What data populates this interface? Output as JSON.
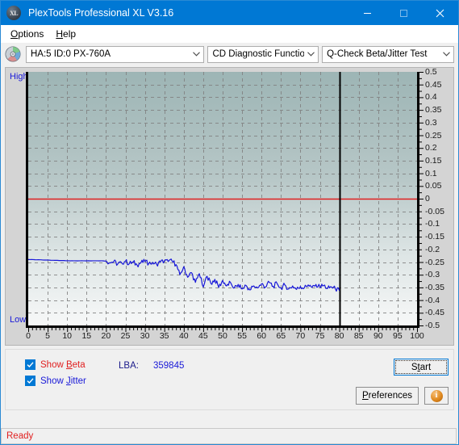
{
  "window": {
    "title": "PlexTools Professional XL V3.16",
    "app_icon": "XL",
    "minimize_label": "–",
    "maximize_label": "□",
    "close_label": "✕"
  },
  "menubar": {
    "items": [
      {
        "label": "Options",
        "accel": "O"
      },
      {
        "label": "Help",
        "accel": "H"
      }
    ]
  },
  "toolbar": {
    "drive_icon": "disc-icon",
    "drive_value": "HA:5 ID:0  PX-760A",
    "function_value": "CD Diagnostic Functions",
    "test_value": "Q-Check Beta/Jitter Test",
    "arrow": "∨"
  },
  "chart_panel": {
    "high_label": "High",
    "low_label": "Low"
  },
  "controls": {
    "show_beta_label": "Show Beta",
    "show_beta_accel": "B",
    "show_beta_checked": true,
    "show_jitter_label": "Show Jitter",
    "show_jitter_accel": "J",
    "show_jitter_checked": true,
    "lba_label": "LBA:",
    "lba_value": "359845",
    "start_label": "Start",
    "start_accel": "t",
    "preferences_label": "Preferences",
    "preferences_accel": "P",
    "info_label": "i"
  },
  "statusbar": {
    "text": "Ready"
  },
  "colors": {
    "titlebar": "#0078d4",
    "beta_line": "#1818d8",
    "zero_line": "#e02020",
    "beta_label": "#e02020",
    "jitter_label": "#1818d8",
    "status_text": "#e02020",
    "plot_top": "#9db5b5",
    "plot_bottom": "#f7f8f8",
    "gridline": "#808080"
  },
  "chart_data": {
    "type": "line",
    "title": "Q-Check Beta/Jitter Test",
    "xlabel": "",
    "ylabel": "",
    "xlim": [
      0,
      100
    ],
    "ylim": [
      -0.5,
      0.5
    ],
    "grid": true,
    "legend_position": "none",
    "x_ticks": [
      0,
      5,
      10,
      15,
      20,
      25,
      30,
      35,
      40,
      45,
      50,
      55,
      60,
      65,
      70,
      75,
      80,
      85,
      90,
      95,
      100
    ],
    "y_ticks": [
      0.5,
      0.45,
      0.4,
      0.35,
      0.3,
      0.25,
      0.2,
      0.15,
      0.1,
      0.05,
      0,
      -0.05,
      -0.1,
      -0.15,
      -0.2,
      -0.25,
      -0.3,
      -0.35,
      -0.4,
      -0.45,
      -0.5
    ],
    "y_axis_left_labels": [
      "High",
      "Low"
    ],
    "annotations": [
      {
        "type": "hline",
        "y": 0,
        "color": "#e02020",
        "label": "zero-reference"
      },
      {
        "type": "vline",
        "x": 80,
        "color": "#000000",
        "label": "data-end-marker"
      }
    ],
    "series": [
      {
        "name": "Beta",
        "color": "#1818d8",
        "x": [
          0,
          1,
          2,
          3,
          4,
          5,
          6,
          7,
          8,
          9,
          10,
          11,
          12,
          13,
          14,
          15,
          16,
          17,
          18,
          19,
          20,
          21,
          22,
          23,
          24,
          25,
          26,
          27,
          28,
          29,
          30,
          31,
          32,
          33,
          34,
          35,
          36,
          37,
          38,
          39,
          40,
          41,
          42,
          43,
          44,
          45,
          46,
          47,
          48,
          49,
          50,
          51,
          52,
          53,
          54,
          55,
          56,
          57,
          58,
          59,
          60,
          61,
          62,
          63,
          64,
          65,
          66,
          67,
          68,
          69,
          70,
          71,
          72,
          73,
          74,
          75,
          76,
          77,
          78,
          79,
          80
        ],
        "values": [
          -0.24,
          -0.24,
          -0.241,
          -0.241,
          -0.242,
          -0.242,
          -0.243,
          -0.243,
          -0.244,
          -0.244,
          -0.245,
          -0.245,
          -0.245,
          -0.245,
          -0.245,
          -0.245,
          -0.245,
          -0.245,
          -0.245,
          -0.245,
          -0.246,
          -0.252,
          -0.248,
          -0.258,
          -0.252,
          -0.247,
          -0.256,
          -0.25,
          -0.262,
          -0.252,
          -0.248,
          -0.256,
          -0.251,
          -0.258,
          -0.25,
          -0.246,
          -0.248,
          -0.246,
          -0.26,
          -0.3,
          -0.268,
          -0.31,
          -0.292,
          -0.33,
          -0.296,
          -0.348,
          -0.306,
          -0.335,
          -0.318,
          -0.35,
          -0.322,
          -0.344,
          -0.33,
          -0.352,
          -0.338,
          -0.356,
          -0.342,
          -0.36,
          -0.344,
          -0.352,
          -0.336,
          -0.348,
          -0.33,
          -0.346,
          -0.334,
          -0.352,
          -0.34,
          -0.356,
          -0.344,
          -0.358,
          -0.346,
          -0.352,
          -0.34,
          -0.35,
          -0.338,
          -0.348,
          -0.342,
          -0.354,
          -0.348,
          -0.356,
          -0.362
        ]
      }
    ]
  }
}
